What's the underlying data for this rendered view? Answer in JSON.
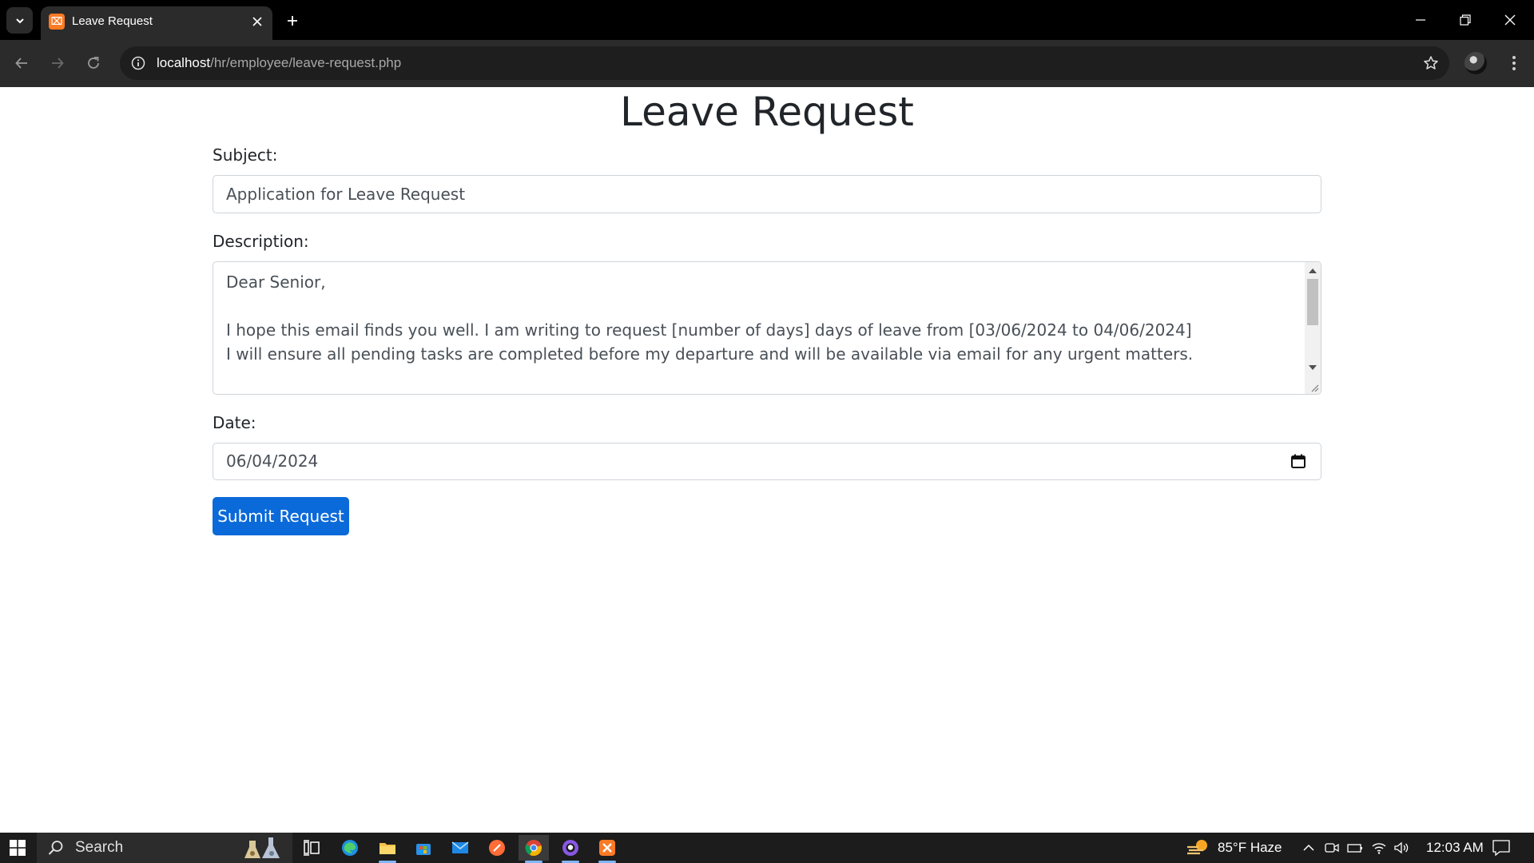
{
  "browser": {
    "tab": {
      "title": "Leave Request",
      "favicon_letter": "⌧"
    },
    "url_host": "localhost",
    "url_path": "/hr/employee/leave-request.php"
  },
  "page": {
    "title": "Leave Request",
    "subject": {
      "label": "Subject:",
      "value": "Application for Leave Request"
    },
    "description": {
      "label": "Description:",
      "lines": [
        "Dear Senior,",
        "",
        "I hope this email finds you well. I am writing to request [number of days] days of leave from [03/06/2024 to 04/06/2024]",
        "I will ensure all pending tasks are completed before my departure and will be available via email for any urgent matters."
      ]
    },
    "date": {
      "label": "Date:",
      "value": "06/04/2024"
    },
    "submit_label": "Submit Request"
  },
  "taskbar": {
    "search_label": "Search",
    "weather": "85°F  Haze",
    "time": "12:03 AM"
  },
  "colors": {
    "primary_button": "#0b6ad9",
    "title_text": "#212529",
    "input_border": "#ced4da"
  }
}
